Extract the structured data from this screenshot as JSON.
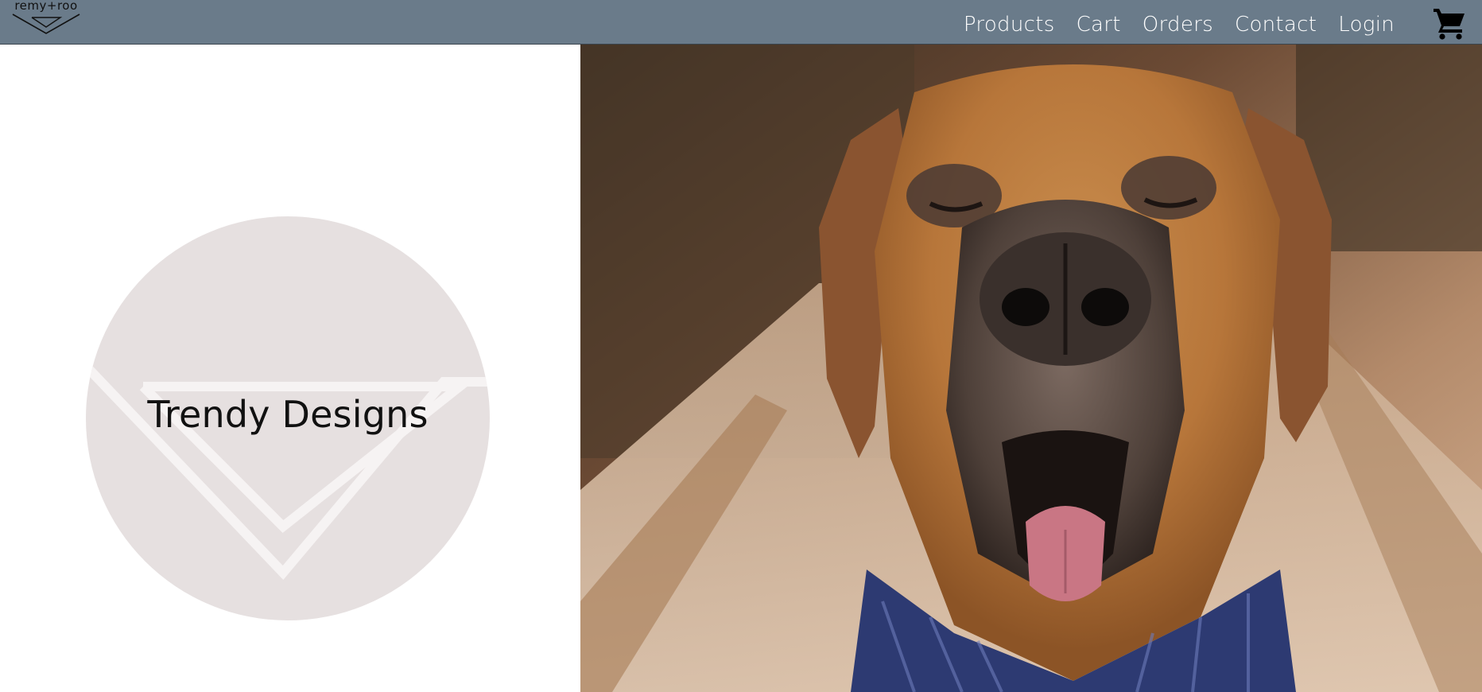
{
  "brand": {
    "name": "remy+roo",
    "logo_icon": "triangle-logo-icon"
  },
  "nav": {
    "links": [
      "Products",
      "Cart",
      "Orders",
      "Contact",
      "Login"
    ],
    "cart_icon": "shopping-cart-icon"
  },
  "hero": {
    "title": "Trendy Designs",
    "image_subject": "close-up of a great dane wearing a blue bandana",
    "circle_color": "#e6e0e0"
  },
  "colors": {
    "navbar": "#6a7b8a",
    "nav_text": "#ffffff",
    "title_text": "#111111"
  }
}
